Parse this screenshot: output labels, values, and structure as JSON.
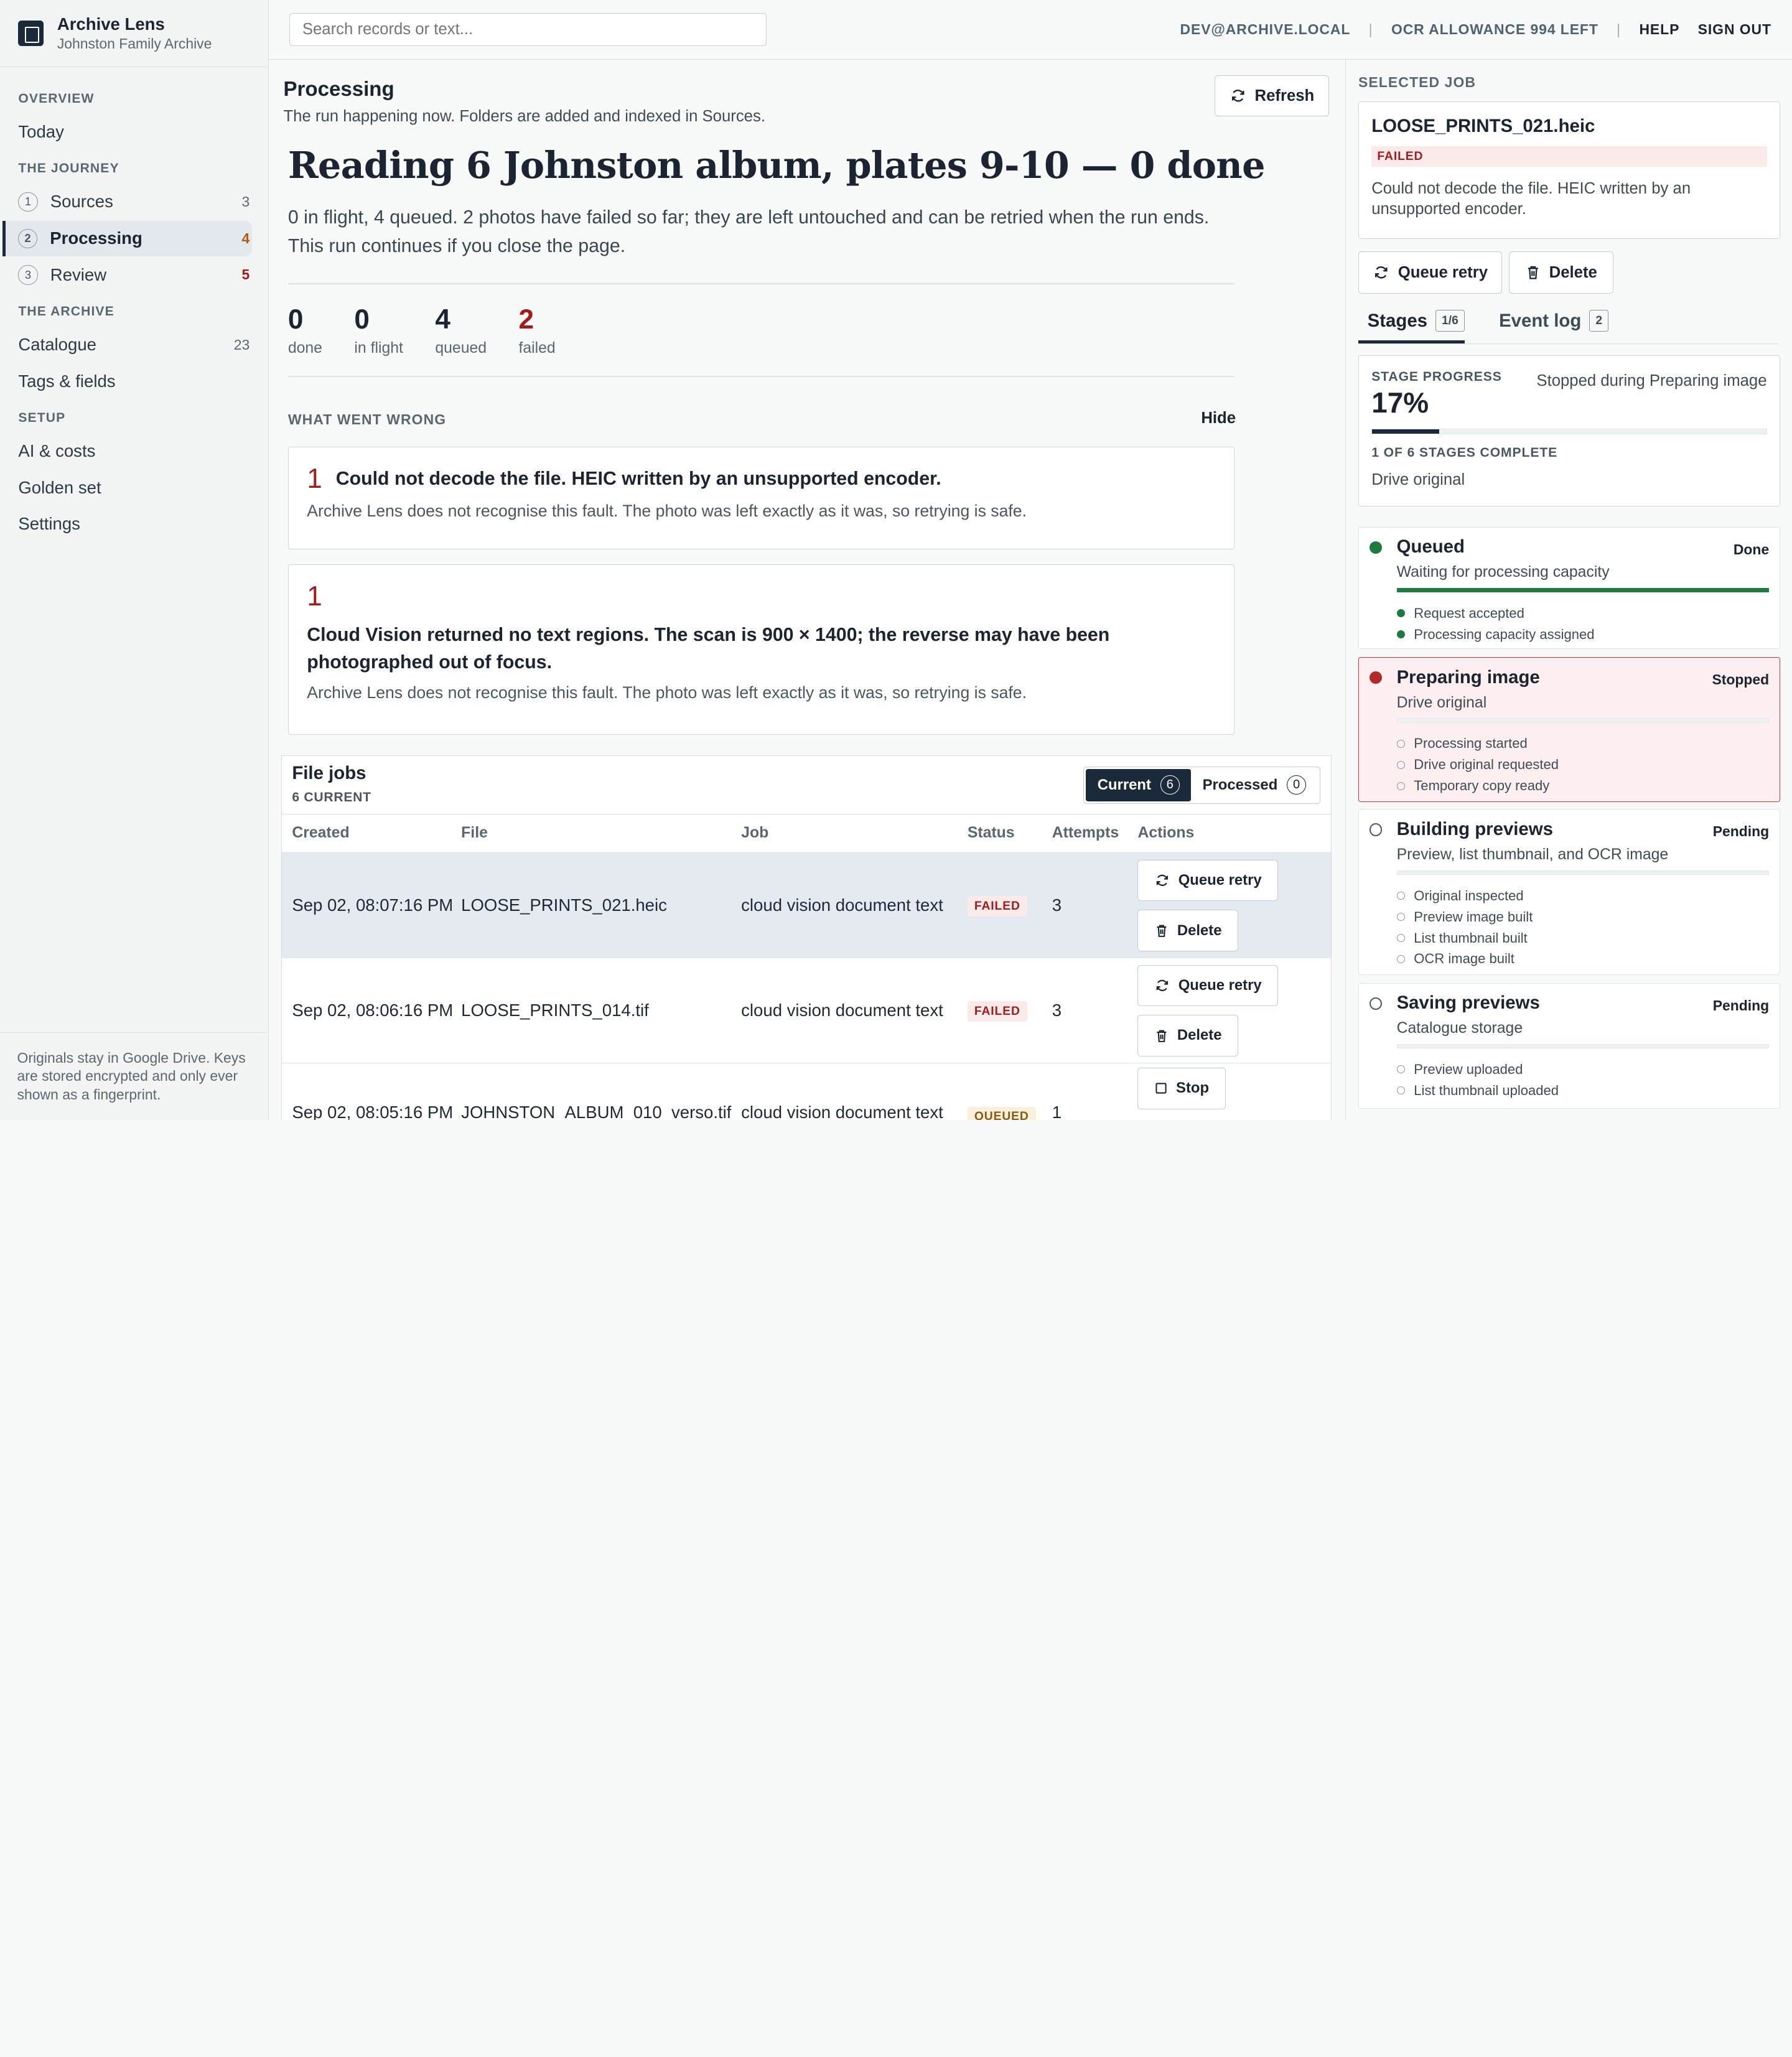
{
  "brand": {
    "title": "Archive Lens",
    "subtitle": "Johnston Family Archive"
  },
  "nav": {
    "overview_heading": "OVERVIEW",
    "today": "Today",
    "journey_heading": "THE JOURNEY",
    "journey": [
      {
        "num": "1",
        "label": "Sources",
        "count": "3"
      },
      {
        "num": "2",
        "label": "Processing",
        "count": "4"
      },
      {
        "num": "3",
        "label": "Review",
        "count": "5"
      }
    ],
    "archive_heading": "THE ARCHIVE",
    "catalogue": "Catalogue",
    "catalogue_count": "23",
    "tags": "Tags & fields",
    "setup_heading": "SETUP",
    "ai": "AI & costs",
    "golden": "Golden set",
    "settings": "Settings",
    "footer": "Originals stay in Google Drive. Keys are stored encrypted and only ever shown as a fingerprint."
  },
  "topbar": {
    "search_placeholder": "Search records or text...",
    "user": "DEV@ARCHIVE.LOCAL",
    "ocr": "OCR ALLOWANCE 994 LEFT",
    "help": "HELP",
    "signout": "SIGN OUT"
  },
  "main": {
    "title": "Processing",
    "subtitle": "The run happening now. Folders are added and indexed in Sources.",
    "refresh": "Refresh",
    "headline": "Reading 6 Johnston album, plates 9-10 — 0 done",
    "lede": "0 in flight, 4 queued. 2 photos have failed so far; they are left untouched and can be retried when the run ends. This run continues if you close the page.",
    "stats": [
      {
        "value": "0",
        "label": "done"
      },
      {
        "value": "0",
        "label": "in flight"
      },
      {
        "value": "4",
        "label": "queued"
      },
      {
        "value": "2",
        "label": "failed"
      }
    ],
    "wrong_heading": "WHAT WENT WRONG",
    "hide": "Hide",
    "errors": [
      {
        "count": "1",
        "title": "Could not decode the file. HEIC written by an unsupported encoder.",
        "detail": "Archive Lens does not recognise this fault. The photo was left exactly as it was, so retrying is safe."
      },
      {
        "count": "1",
        "title": "Cloud Vision returned no text regions. The scan is 900 × 1400; the reverse may have been photographed out of focus.",
        "detail": "Archive Lens does not recognise this fault. The photo was left exactly as it was, so retrying is safe."
      }
    ]
  },
  "jobs": {
    "title": "File jobs",
    "subtitle": "6 CURRENT",
    "seg_current": "Current",
    "seg_current_count": "6",
    "seg_processed": "Processed",
    "seg_processed_count": "0",
    "columns": [
      "Created",
      "File",
      "Job",
      "Status",
      "Attempts",
      "Actions"
    ],
    "rows": [
      {
        "created": "Sep 02, 08:07:16 PM",
        "file": "LOOSE_PRINTS_021.heic",
        "job": "cloud vision document text",
        "status": "FAILED",
        "attempts": "3",
        "action1": "Queue retry",
        "action2": "Delete"
      },
      {
        "created": "Sep 02, 08:06:16 PM",
        "file": "LOOSE_PRINTS_014.tif",
        "job": "cloud vision document text",
        "status": "FAILED",
        "attempts": "3",
        "action1": "Queue retry",
        "action2": "Delete"
      },
      {
        "created": "Sep 02, 08:05:16 PM",
        "file": "JOHNSTON_ALBUM_010_verso.tif",
        "job": "cloud vision document text",
        "status": "QUEUED",
        "attempts": "1",
        "action1": "Stop"
      }
    ]
  },
  "selected": {
    "heading": "SELECTED JOB",
    "name": "LOOSE_PRINTS_021.heic",
    "status": "FAILED",
    "message": "Could not decode the file. HEIC written by an unsupported encoder.",
    "retry": "Queue retry",
    "delete": "Delete",
    "tab_stages": "Stages",
    "tab_stages_count": "1/6",
    "tab_log": "Event log",
    "tab_log_count": "2",
    "progress_label": "STAGE PROGRESS",
    "progress_value": "17%",
    "progress_fraction": 0.17,
    "progress_note": "Stopped during Preparing image",
    "complete_label": "1 OF 6 STAGES COMPLETE",
    "complete_detail": "Drive original"
  },
  "stages": [
    {
      "title": "Queued",
      "state": "Done",
      "sub": "Waiting for processing capacity",
      "steps": [
        "Request accepted",
        "Processing capacity assigned"
      ]
    },
    {
      "title": "Preparing image",
      "state": "Stopped",
      "sub": "Drive original",
      "steps": [
        "Processing started",
        "Drive original requested",
        "Temporary copy ready"
      ]
    },
    {
      "title": "Building previews",
      "state": "Pending",
      "sub": "Preview, list thumbnail, and OCR image",
      "steps": [
        "Original inspected",
        "Preview image built",
        "List thumbnail built",
        "OCR image built"
      ]
    },
    {
      "title": "Saving previews",
      "state": "Pending",
      "sub": "Catalogue storage",
      "steps": [
        "Preview uploaded",
        "List thumbnail uploaded"
      ]
    }
  ]
}
